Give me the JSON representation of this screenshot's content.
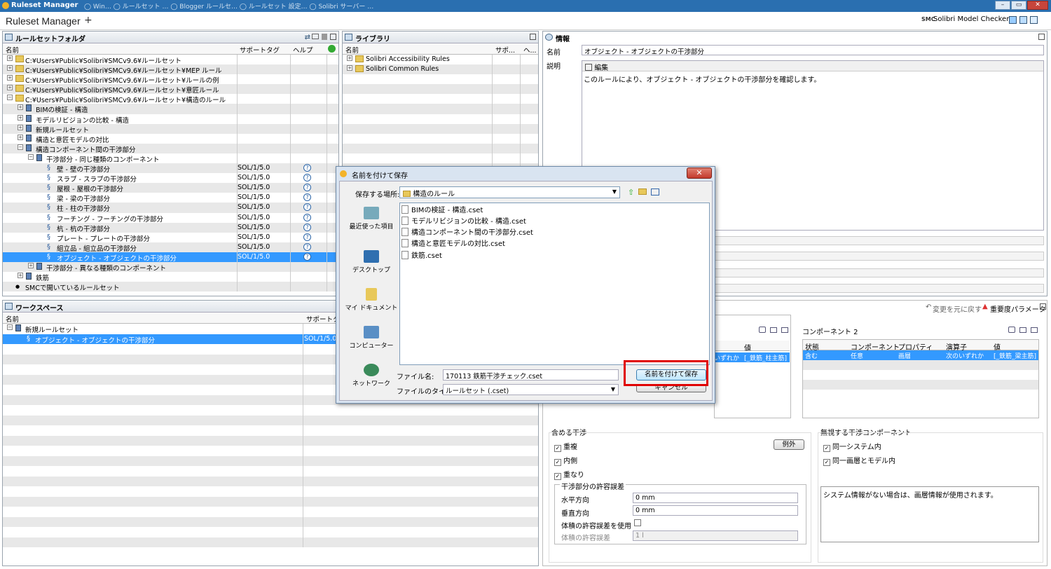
{
  "window": {
    "title": "Ruleset Manager",
    "bg_tabs": "◯ Win… ◯ ルールセット … ◯ Blogger ルールセ… ◯ ルールセット 設定… ◯ Solibri サーバー …",
    "min": "–",
    "max": "▭",
    "close": "✕"
  },
  "app": {
    "title": "Ruleset Manager",
    "add_tab": "+",
    "checker": "Solibri Model Checker"
  },
  "ruleset_folder": {
    "title": "ルールセットフォルダ",
    "columns": [
      "名前",
      "サポートタグ",
      "ヘルプ"
    ],
    "rows": [
      {
        "label": "C:¥Users¥Public¥Solibri¥SMCv9.6¥ルールセット",
        "lvl": 0,
        "type": "folder",
        "exp": "+"
      },
      {
        "label": "C:¥Users¥Public¥Solibri¥SMCv9.6¥ルールセット¥MEP ルール",
        "lvl": 0,
        "type": "folder",
        "exp": "+"
      },
      {
        "label": "C:¥Users¥Public¥Solibri¥SMCv9.6¥ルールセット¥ルールの例",
        "lvl": 0,
        "type": "folder",
        "exp": "+"
      },
      {
        "label": "C:¥Users¥Public¥Solibri¥SMCv9.6¥ルールセット¥意匠ルール",
        "lvl": 0,
        "type": "folder",
        "exp": "+"
      },
      {
        "label": "C:¥Users¥Public¥Solibri¥SMCv9.6¥ルールセット¥構造のルール",
        "lvl": 0,
        "type": "folder",
        "exp": "−"
      },
      {
        "label": "BIMの検証 - 構造",
        "lvl": 1,
        "type": "book",
        "exp": "+"
      },
      {
        "label": "モデルリビジョンの比較 - 構造",
        "lvl": 1,
        "type": "book",
        "exp": "+"
      },
      {
        "label": "新規ルールセット",
        "lvl": 1,
        "type": "book",
        "exp": "+"
      },
      {
        "label": "構造と意匠モデルの対比",
        "lvl": 1,
        "type": "book",
        "exp": "+"
      },
      {
        "label": "構造コンポーネント間の干渉部分",
        "lvl": 1,
        "type": "book",
        "exp": "−"
      },
      {
        "label": "干渉部分 - 同じ種類のコンポーネント",
        "lvl": 2,
        "type": "book",
        "exp": "−"
      },
      {
        "label": "壁 - 壁の干渉部分",
        "lvl": 3,
        "type": "rule",
        "tag": "SOL/1/5.0"
      },
      {
        "label": "スラブ - スラブの干渉部分",
        "lvl": 3,
        "type": "rule",
        "tag": "SOL/1/5.0"
      },
      {
        "label": "屋根 - 屋根の干渉部分",
        "lvl": 3,
        "type": "rule",
        "tag": "SOL/1/5.0"
      },
      {
        "label": "梁 - 梁の干渉部分",
        "lvl": 3,
        "type": "rule",
        "tag": "SOL/1/5.0"
      },
      {
        "label": "柱 - 柱の干渉部分",
        "lvl": 3,
        "type": "rule",
        "tag": "SOL/1/5.0"
      },
      {
        "label": "フーチング - フーチングの干渉部分",
        "lvl": 3,
        "type": "rule",
        "tag": "SOL/1/5.0"
      },
      {
        "label": "杭 - 杭の干渉部分",
        "lvl": 3,
        "type": "rule",
        "tag": "SOL/1/5.0"
      },
      {
        "label": "プレート - プレートの干渉部分",
        "lvl": 3,
        "type": "rule",
        "tag": "SOL/1/5.0"
      },
      {
        "label": "組立品 - 組立品の干渉部分",
        "lvl": 3,
        "type": "rule",
        "tag": "SOL/1/5.0"
      },
      {
        "label": "オブジェクト - オブジェクトの干渉部分",
        "lvl": 3,
        "type": "rule",
        "tag": "SOL/1/5.0",
        "selected": true
      },
      {
        "label": "干渉部分 - 異なる種類のコンポーネント",
        "lvl": 2,
        "type": "book",
        "exp": "+"
      },
      {
        "label": "鉄筋",
        "lvl": 1,
        "type": "book",
        "exp": "+"
      },
      {
        "label": "SMCで開いているルールセット",
        "lvl": 0,
        "type": "dot"
      }
    ]
  },
  "library": {
    "title": "ライブラリ",
    "columns": [
      "名前",
      "サポ...",
      "ヘ..."
    ],
    "rows": [
      "Solibri Accessibility Rules",
      "Solibri Common Rules"
    ]
  },
  "info": {
    "title": "情報",
    "name_label": "名前",
    "name_value": "オブジェクト - オブジェクトの干渉部分",
    "desc_label": "説明",
    "edit_label": "編集",
    "desc_text": "このルールにより、オブジェクト - オブジェクトの干渉部分を確認します。"
  },
  "workspace": {
    "title": "ワークスペース",
    "columns": [
      "名前",
      "サポートタグ"
    ],
    "rows": [
      {
        "label": "新規ルールセット",
        "tag": ""
      },
      {
        "label": "オブジェクト - オブジェクトの干渉部分",
        "tag": "SOL/1/5.0",
        "selected": true
      }
    ]
  },
  "params": {
    "undo": "変更を元に戻す",
    "severity": "重要度パラメータ",
    "comp1": {
      "cols": [
        "値"
      ],
      "row": [
        "いずれか",
        "[_鉄筋_柱主筋]"
      ]
    },
    "comp2": {
      "title": "コンポーネント 2",
      "cols": [
        "状態",
        "コンポーネント",
        "プロパティ",
        "演算子",
        "値"
      ],
      "row": [
        "含む",
        "任意",
        "画層",
        "次のいずれか",
        "[_鉄筋_梁主筋]"
      ]
    },
    "include": {
      "title": "含める干渉",
      "items": [
        "重複",
        "内側",
        "重なり"
      ],
      "except_btn": "例外"
    },
    "tolerance": {
      "title": "干渉部分の許容誤差",
      "horiz_label": "水平方向",
      "horiz_value": "0 mm",
      "vert_label": "垂直方向",
      "vert_value": "0 mm",
      "vol_use_label": "体積の許容誤差を使用",
      "vol_label": "体積の許容誤差",
      "vol_value": "1 l"
    },
    "ignore": {
      "title": "無視する干渉コンポーネント",
      "items": [
        "同一システム内",
        "同一画層とモデル内"
      ],
      "note": "システム情報がない場合は、画層情報が使用されます。"
    }
  },
  "dialog": {
    "title": "名前を付けて保存",
    "location_label": "保存する場所:",
    "location_value": "構造のルール",
    "places": [
      "最近使った項目",
      "デスクトップ",
      "マイ ドキュメント",
      "コンピューター",
      "ネットワーク"
    ],
    "files": [
      "BIMの検証 - 構造.cset",
      "モデルリビジョンの比較 - 構造.cset",
      "構造コンポーネント間の干渉部分.cset",
      "構造と意匠モデルの対比.cset",
      "鉄筋.cset"
    ],
    "filename_label": "ファイル名:",
    "filename_value": "170113 鉄筋干渉チェック.cset",
    "filetype_label": "ファイルのタイプ:",
    "filetype_value": "ルールセット (.cset)",
    "save_btn": "名前を付けて保存",
    "cancel_btn": "キャンセル"
  },
  "colors": {
    "selection": "#3399ff",
    "title_bar": "#2a6fb0",
    "highlight_box": "#e00000"
  }
}
